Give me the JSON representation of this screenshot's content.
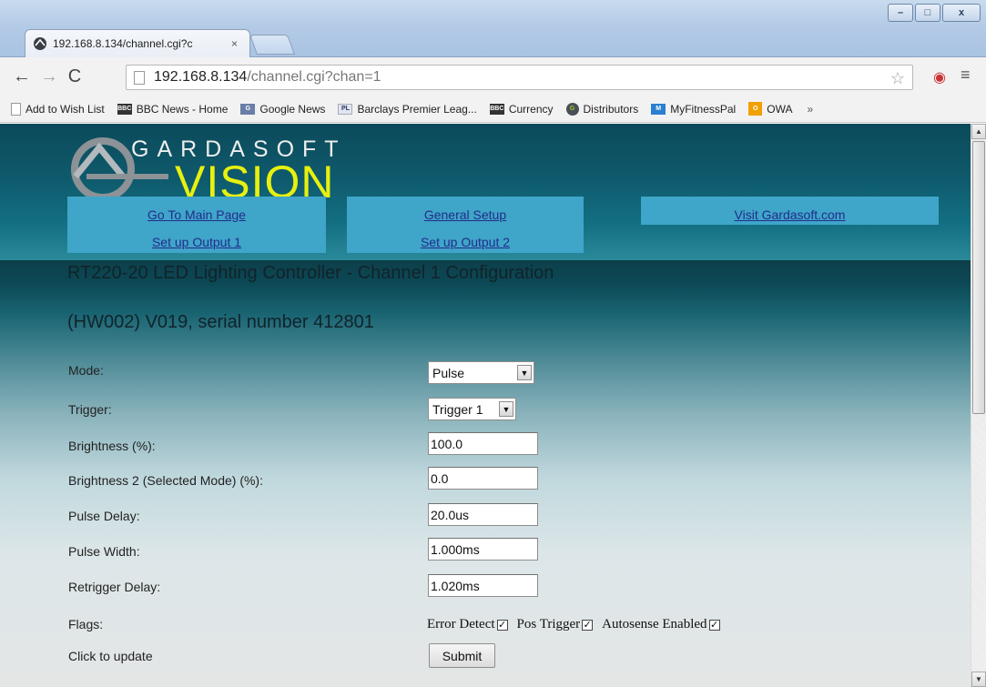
{
  "browser": {
    "tab_title": "192.168.8.134/channel.cgi?c",
    "tab_close": "×",
    "url_host": "192.168.8.134",
    "url_path": "/channel.cgi?chan=1",
    "window_controls": {
      "minimize": "–",
      "maximize": "□",
      "close": "x"
    },
    "bookmarks": [
      {
        "label": "Add to Wish List",
        "icon": "page-icon",
        "badge": ""
      },
      {
        "label": "BBC News - Home",
        "icon": "bbc-icon",
        "badge": "BBC"
      },
      {
        "label": "Google News",
        "icon": "google-news-icon",
        "badge": "G"
      },
      {
        "label": "Barclays Premier Leag...",
        "icon": "premier-league-icon",
        "badge": "PL"
      },
      {
        "label": "Currency",
        "icon": "bbc-icon",
        "badge": "BBC"
      },
      {
        "label": "Distributors",
        "icon": "gardasoft-icon",
        "badge": "G"
      },
      {
        "label": "MyFitnessPal",
        "icon": "myfitnesspal-icon",
        "badge": "M"
      },
      {
        "label": "OWA",
        "icon": "owa-icon",
        "badge": "O"
      }
    ],
    "bookmarks_more": "»"
  },
  "logo": {
    "top": "GARDASOFT",
    "bottom": "VISION"
  },
  "nav": {
    "main_page": "Go To Main Page",
    "general_setup": "General Setup",
    "visit_site": "Visit Gardasoft.com",
    "output1": "Set up Output 1",
    "output2": "Set up Output 2"
  },
  "page": {
    "title": "RT220-20 LED Lighting Controller - Channel 1 Configuration",
    "subtitle": "(HW002) V019, serial number 412801"
  },
  "form": {
    "mode_label": "Mode:",
    "mode_value": "Pulse",
    "trigger_label": "Trigger:",
    "trigger_value": "Trigger 1",
    "brightness_label": "Brightness (%):",
    "brightness_value": "100.0",
    "brightness2_label": "Brightness 2 (Selected Mode) (%):",
    "brightness2_value": "0.0",
    "pulse_delay_label": "Pulse Delay:",
    "pulse_delay_value": "20.0us",
    "pulse_width_label": "Pulse Width:",
    "pulse_width_value": "1.000ms",
    "retrigger_label": "Retrigger Delay:",
    "retrigger_value": "1.020ms",
    "flags_label": "Flags:",
    "flag_error": "Error Detect",
    "flag_pos": "Pos Trigger",
    "flag_autosense": "Autosense Enabled",
    "flags_checked": [
      true,
      true,
      true
    ],
    "update_label": "Click to update",
    "submit_label": "Submit"
  },
  "colors": {
    "nav_block": "#3fa5c9",
    "link": "#222d8a",
    "logo_vision": "#e7f00f"
  }
}
